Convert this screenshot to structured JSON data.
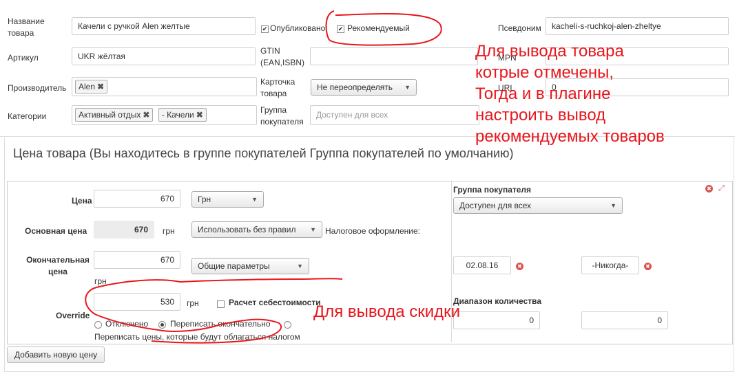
{
  "product": {
    "name_label": "Название товара",
    "name_value": "Качели с ручкой Alen  желтые",
    "published_label": "Опубликовано",
    "featured_label": "Рекомендуемый",
    "alias_label": "Псевдоним",
    "alias_value": "kacheli-s-ruchkoj-alen-zheltye",
    "sku_label": "Артикул",
    "sku_value": "UKR жёлтая",
    "gtin_label_1": "GTIN",
    "gtin_label_2": "(EAN,ISBN)",
    "gtin_value": "",
    "mpn_label": "MPN",
    "mpn_value": "",
    "manufacturer_label": "Производитель",
    "manufacturer_tags": [
      "Alen"
    ],
    "card_label_1": "Карточка",
    "card_label_2": "товара",
    "card_select": "Не переопределять",
    "url_label": "URL",
    "url_value": "0",
    "categories_label": "Категории",
    "category_tags": [
      "Активный отдых",
      "- Качели"
    ],
    "group_label_1": "Группа",
    "group_label_2": "покупателя",
    "group_placeholder": "Доступен для всех"
  },
  "price_section": {
    "title": "Цена товара (Вы находитесь в группе покупателей Группа покупателей по умолчанию)",
    "price_label": "Цена",
    "price_value": "670",
    "currency_select": "Грн",
    "base_price_label": "Основная цена",
    "base_price_value": "670",
    "base_currency": "грн",
    "rules_select": "Использовать без правил",
    "tax_label": "Налоговое оформление:",
    "final_price_label_1": "Окончательная",
    "final_price_label_2": "цена",
    "final_price_value": "670",
    "final_currency": "грн",
    "general_select": "Общие параметры",
    "override_label": "Override",
    "override_value": "530",
    "override_currency": "грн",
    "cost_calc_label": "Расчет себестоимости",
    "radio_off": "Отключено",
    "radio_override_final": "Переписать окончательно",
    "radio_override_taxed": "Переписать цены, которые будут облагаться налогом",
    "group_title": "Группа покупателя",
    "group_select": "Доступен для всех",
    "date_from": "02.08.16",
    "date_to": "-Никогда-",
    "qty_title": "Диапазон количества",
    "qty_from": "0",
    "qty_to": "0",
    "add_price_button": "Добавить новую цену"
  },
  "annotations": {
    "note_featured": [
      "Для вывода товара",
      "котрые отмечены,",
      "Тогда и в плагине",
      "настроить вывод",
      "рекомендуемых товаров"
    ],
    "note_discount": "Для вывода скидки"
  },
  "colors": {
    "annotation": "#e8161c",
    "remove_icon": "#d9534f"
  }
}
